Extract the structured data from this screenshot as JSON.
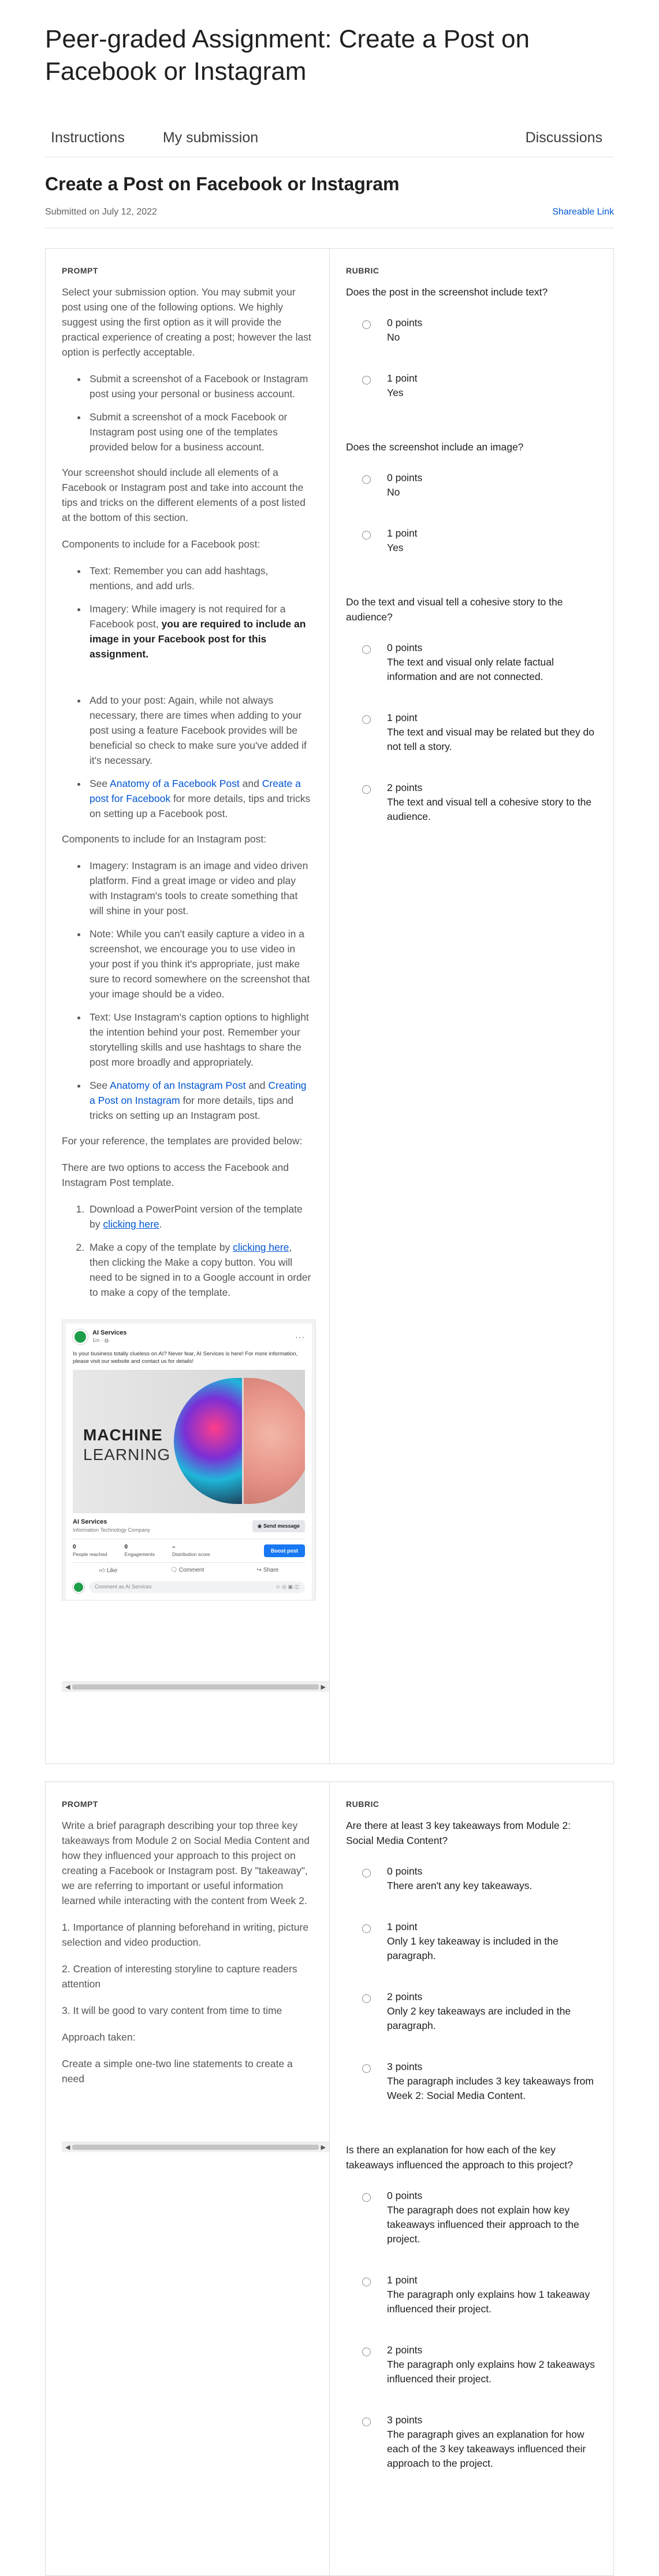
{
  "page": {
    "title": "Peer-graded Assignment: Create a Post on Facebook or Instagram"
  },
  "tabs": [
    {
      "label": "Instructions"
    },
    {
      "label": "My submission"
    },
    {
      "label": "Discussions"
    }
  ],
  "submission": {
    "title": "Create a Post on Facebook or Instagram",
    "submitted": "Submitted on July 12, 2022",
    "share_link": "Shareable Link"
  },
  "labels": {
    "prompt": "PROMPT",
    "rubric": "RUBRIC"
  },
  "prompt1": {
    "intro": "Select your submission option. You may submit your post using one of the following options. We highly suggest using the first option as it will provide the practical experience of creating a post; however the last option is perfectly acceptable.",
    "options": [
      "Submit a screenshot of a Facebook or Instagram post using your personal or business account.",
      "Submit a screenshot of a mock Facebook or Instagram post using one of the templates provided below for a business account."
    ],
    "screenshot_note": "Your screenshot should include all elements of a Facebook or Instagram post and take into account the tips and tricks on the different elements of a post listed at the bottom of this section.",
    "fb_components_heading": "Components to include for a Facebook post:",
    "fb_text": "Text: Remember you can add hashtags, mentions, and add urls.",
    "fb_imagery_pre": "Imagery: While imagery is not required for a Facebook post, ",
    "fb_imagery_bold": "you are required to include an image in your Facebook post for this assignment.",
    "fb_add": "Add to your post: Again, while not always necessary, there are times when adding to your post using a feature Facebook provides will be beneficial so check to make sure you've added if it's necessary.",
    "fb_see": "See ",
    "fb_link1": "Anatomy of a Facebook Post",
    "fb_and": " and ",
    "fb_link2": "Create a post for Facebook",
    "fb_see_tail": " for more details, tips and tricks on setting up a Facebook post.",
    "ig_components_heading": "Components to include for an Instagram post:",
    "ig_imagery": "Imagery: Instagram is an image and video driven platform. Find a great image or video and play with Instagram's tools to create something that will shine in your post.",
    "ig_note": "Note: While you can't easily capture a video in a screenshot, we encourage you to use video in your post if you think it's appropriate, just make sure to record somewhere on the screenshot that your image should be a video.",
    "ig_text": "Text: Use Instagram's caption options to highlight the intention behind your post. Remember your storytelling skills and use hashtags to share the post more broadly and appropriately.",
    "ig_see": "See ",
    "ig_link1": "Anatomy of an Instagram Post",
    "ig_and": " and ",
    "ig_link2": "Creating a Post on Instagram",
    "ig_see_tail": " for more details, tips and tricks on setting up an Instagram post.",
    "reference": "For your reference, the templates are provided below:",
    "two_options": "There are two options to access the Facebook and Instagram Post template.",
    "step1_pre": "Download a PowerPoint version of the template by ",
    "step1_link": "clicking here",
    "step1_tail": ".",
    "step2_pre": "Make a copy of the template by ",
    "step2_link": "clicking here",
    "step2_tail": ", then clicking the Make a copy button. You will need to be signed in to a Google account in order to make a copy of the template."
  },
  "fb_post": {
    "page_name": "AI Services",
    "time": "1m · ",
    "caption": "Is your business totally clueless on AI? Never fear, AI Services is here! For more information, please visit our website and contact us for details!",
    "image_line1": "MACHINE",
    "image_line2": "LEARNING",
    "biz_name": "AI Services",
    "biz_sub": "Information Technology Company",
    "send": "Send message",
    "stats": [
      {
        "value": "0",
        "label": "People reached"
      },
      {
        "value": "0",
        "label": "Engagements"
      },
      {
        "value": "–",
        "label": "Distribution score"
      }
    ],
    "boost": "Boost post",
    "like": "Like",
    "comment": "Comment",
    "share": "Share",
    "comment_placeholder": "Comment as AI Services"
  },
  "prompt2": {
    "intro": "Write a brief paragraph describing your top three key takeaways from Module 2 on Social Media Content and how they influenced your approach to this project on creating a Facebook or Instagram post.  By \"takeaway\", we are referring to important or useful information learned while interacting with the content from Week 2.",
    "t1": "1. Importance of planning beforehand in writing, picture selection and video production.",
    "t2": "2. Creation of interesting storyline to capture readers attention",
    "t3": "3. It will be good to vary content from time to time",
    "approach": "Approach taken:",
    "approach_text": "Create a simple one-two line statements to create a need"
  },
  "rubric1": [
    {
      "question": "Does the post in the screenshot include text?",
      "options": [
        {
          "points": "0 points",
          "desc": "No"
        },
        {
          "points": "1 point",
          "desc": "Yes"
        }
      ]
    },
    {
      "question": "Does the screenshot include an image?",
      "options": [
        {
          "points": "0 points",
          "desc": "No"
        },
        {
          "points": "1 point",
          "desc": "Yes"
        }
      ]
    },
    {
      "question": "Do the text and visual tell a cohesive story to the audience?",
      "options": [
        {
          "points": "0 points",
          "desc": "The text and visual only relate factual information and are not connected."
        },
        {
          "points": "1 point",
          "desc": "The text and visual may be related but they do not tell a story."
        },
        {
          "points": "2 points",
          "desc": "The text and visual tell a cohesive story to the audience."
        }
      ]
    }
  ],
  "rubric2": [
    {
      "question": "Are there at least 3 key takeaways from Module 2: Social Media Content?",
      "options": [
        {
          "points": "0 points",
          "desc": "There aren't any key takeaways."
        },
        {
          "points": "1 point",
          "desc": "Only 1 key takeaway is included in the paragraph."
        },
        {
          "points": "2 points",
          "desc": "Only 2 key takeaways are included in the paragraph."
        },
        {
          "points": "3 points",
          "desc": "The paragraph includes 3 key takeaways from Week 2: Social Media Content."
        }
      ]
    },
    {
      "question": "Is there an explanation for how each of the key takeaways influenced the approach to this project?",
      "options": [
        {
          "points": "0 points",
          "desc": "The paragraph does not explain how key takeaways influenced their approach to the project."
        },
        {
          "points": "1 point",
          "desc": "The paragraph only explains how 1 takeaway influenced their project."
        },
        {
          "points": "2 points",
          "desc": "The paragraph only explains how 2 takeaways influenced their project."
        },
        {
          "points": "3 points",
          "desc": "The paragraph gives an explanation for how each of the 3 key takeaways influenced their approach to the project."
        }
      ]
    }
  ]
}
